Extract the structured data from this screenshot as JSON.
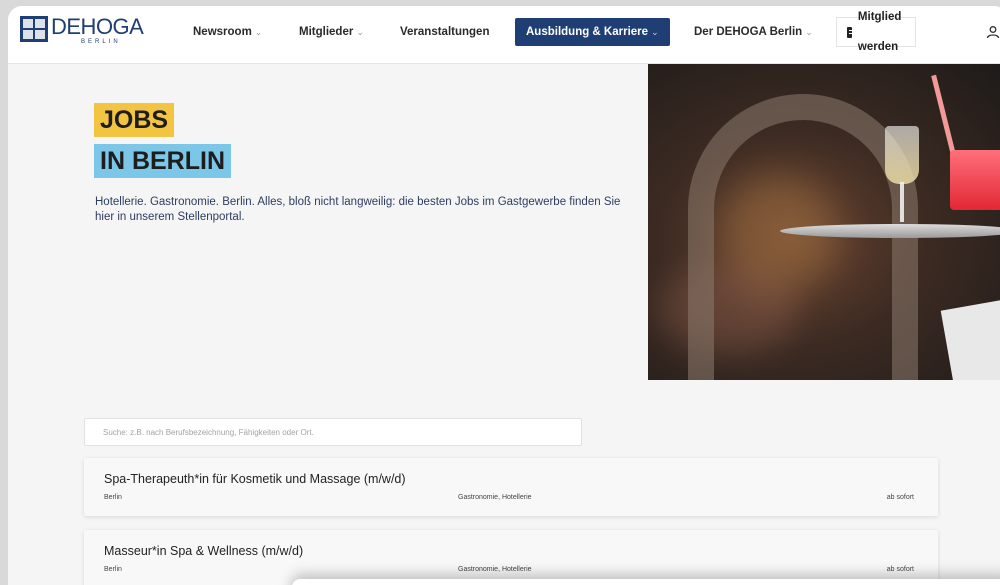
{
  "logo": {
    "name": "DEHOGA",
    "sub": "BERLIN"
  },
  "nav": {
    "items": [
      {
        "label": "Newsroom",
        "chevron": "⌄"
      },
      {
        "label": "Mitglieder",
        "chevron": "⌄"
      },
      {
        "label": "Veranstaltungen",
        "chevron": ""
      },
      {
        "label": "Ausbildung & Karriere",
        "chevron": "⌄"
      },
      {
        "label": "Der DEHOGA Berlin",
        "chevron": "⌄"
      }
    ],
    "member_button": "Mitglied werden"
  },
  "hero": {
    "line1": "JOBS",
    "line2": "IN BERLIN",
    "intro": "Hotellerie. Gastronomie. Berlin.  Alles, bloß nicht langweilig: die besten Jobs im Gastgewerbe finden Sie hier in unserem Stellenportal."
  },
  "search": {
    "placeholder": "Suche: z.B. nach Berufsbezeichnung, Fähigkeiten oder Ort."
  },
  "jobs": [
    {
      "title": "Spa-Therapeuth*in für Kosmetik und Massage (m/w/d)",
      "location": "Berlin",
      "category": "Gastronomie, Hotellerie",
      "start": "ab sofort"
    },
    {
      "title": "Masseur*in Spa & Wellness (m/w/d)",
      "location": "Berlin",
      "category": "Gastronomie, Hotellerie",
      "start": "ab sofort"
    }
  ],
  "colors": {
    "brand": "#1f3e74",
    "tag_yellow": "#f3c441",
    "tag_blue": "#7cc6e8"
  }
}
